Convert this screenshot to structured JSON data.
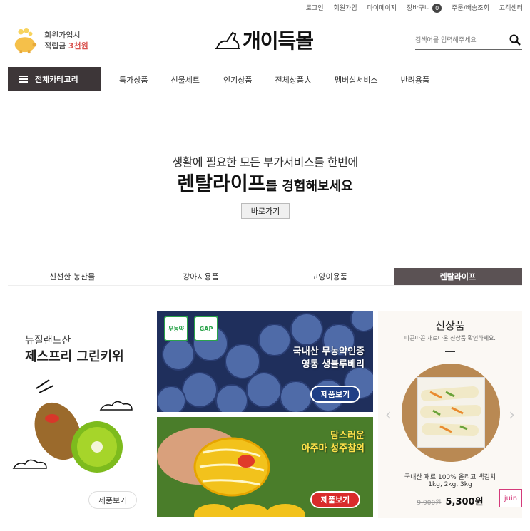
{
  "topbar": {
    "login": "로그인",
    "join": "회원가입",
    "mypage": "마이페이지",
    "cart": "장바구니",
    "cart_count": "0",
    "orders": "주문/배송조회",
    "support": "고객센터"
  },
  "promo": {
    "line1": "회원가입시",
    "line2_prefix": "적립금 ",
    "line2_highlight": "3천원"
  },
  "logo": {
    "text": "개이득몰"
  },
  "search": {
    "placeholder": "검색어를 입력해주세요"
  },
  "nav": {
    "category_label": "전체카테고리",
    "items": [
      "특가상품",
      "선물세트",
      "인기상품",
      "전체상품人",
      "멤버십서비스",
      "반려용품"
    ]
  },
  "hero": {
    "subtitle": "생활에 필요한 모든 부가서비스를 한번에",
    "title_big": "렌탈라이프",
    "title_rest": "를 경험해보세요",
    "button": "바로가기"
  },
  "tabs": [
    "신선한 농산물",
    "강아지용품",
    "고양이용품",
    "렌탈라이프"
  ],
  "products": {
    "kiwi": {
      "origin": "뉴질랜드산",
      "name": "제스프리 그린키위",
      "button": "제품보기"
    },
    "blueberry": {
      "badge1": "무농약",
      "badge2": "GAP",
      "line1": "국내산 무농약인증",
      "line2": "영동 생블루베리",
      "button": "제품보기"
    },
    "melon": {
      "line1": "탐스러운",
      "line2": "아주마 성주참외",
      "button": "제품보기"
    }
  },
  "new_products": {
    "title": "신상품",
    "subtitle": "따끈따끈 새로나온 신상품 확인하세요.",
    "item_name": "국내산 재료 100% 올리고 백김치",
    "item_options": "1kg, 2kg, 3kg",
    "old_price": "9,900원",
    "price": "5,300원",
    "prev": "‹",
    "next": "›"
  },
  "widget": {
    "label": "juin"
  },
  "colors": {
    "nav_dark": "#3d3638",
    "tab_active": "#5b5254",
    "highlight_red": "#d9534f",
    "blue_button": "#1f3f86",
    "red_button": "#d92b2b"
  }
}
